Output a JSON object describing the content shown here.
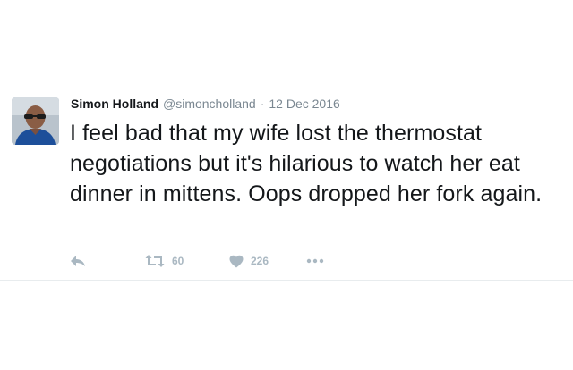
{
  "tweet": {
    "author_name": "Simon Holland",
    "handle": "@simoncholland",
    "separator": "·",
    "date": "12 Dec 2016",
    "text": "I feel bad that my wife lost the thermostat negotiations but it's hilarious to watch her eat dinner in mittens. Oops dropped her fork again.",
    "avatar_icon": "profile-photo"
  },
  "actions": {
    "reply_icon": "reply-icon",
    "retweet_icon": "retweet-icon",
    "retweet_count": "60",
    "like_icon": "heart-icon",
    "like_count": "226",
    "more_icon": "more-dots-icon"
  },
  "colors": {
    "text": "#14171a",
    "secondary": "#7a8791",
    "action": "#aab8c2",
    "divider": "#e8ecee"
  }
}
